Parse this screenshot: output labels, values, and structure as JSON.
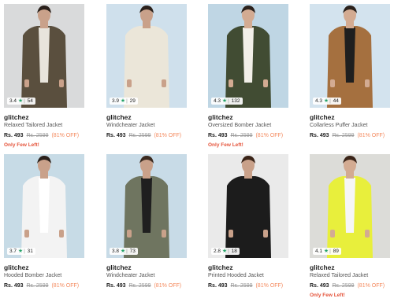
{
  "products": [
    {
      "brand": "glitchez",
      "name": "Relaxed Tailored Jacket",
      "rating": "3.4",
      "reviews": "54",
      "price": "Rs. 493",
      "mrp": "Rs. 2599",
      "discount": "(81% OFF)",
      "stock": "Only Few Left!",
      "bg": "#d9dadb",
      "jacket": "#5a4f3e",
      "shirt": "#e8e4dc",
      "pants": "#3e5e86",
      "skin": "#c9a18a",
      "hair": "#2a211c"
    },
    {
      "brand": "glitchez",
      "name": "Windcheater Jacket",
      "rating": "3.9",
      "reviews": "29",
      "price": "Rs. 493",
      "mrp": "Rs. 2599",
      "discount": "(81% OFF)",
      "stock": "",
      "bg": "#cfe0ec",
      "jacket": "#ebe6d9",
      "shirt": "#ebe6d9",
      "pants": "#c08048",
      "skin": "#c9a18a",
      "hair": "#2a211c"
    },
    {
      "brand": "glitchez",
      "name": "Oversized Bomber Jacket",
      "rating": "4.3",
      "reviews": "132",
      "price": "Rs. 493",
      "mrp": "Rs. 2599",
      "discount": "(81% OFF)",
      "stock": "Only Few Left!",
      "bg": "#bfd6e4",
      "jacket": "#414c33",
      "shirt": "#f2efe8",
      "pants": "#ece8df",
      "skin": "#d3ab92",
      "hair": "#2a211c"
    },
    {
      "brand": "glitchez",
      "name": "Collarless Puffer Jacket",
      "rating": "4.3",
      "reviews": "44",
      "price": "Rs. 493",
      "mrp": "Rs. 2599",
      "discount": "(81% OFF)",
      "stock": "",
      "bg": "#d3e3ee",
      "jacket": "#a5703f",
      "shirt": "#1f1f1f",
      "pants": "#1f1f1f",
      "skin": "#d3ab92",
      "hair": "#2a211c"
    },
    {
      "brand": "glitchez",
      "name": "Hooded Bomber Jacket",
      "rating": "3.7",
      "reviews": "31",
      "price": "Rs. 493",
      "mrp": "Rs. 2599",
      "discount": "(81% OFF)",
      "stock": "",
      "bg": "#c7dbe6",
      "jacket": "#f3f3f3",
      "shirt": "#ffffff",
      "pants": "#4a6a93",
      "skin": "#c9a18a",
      "hair": "#2a211c"
    },
    {
      "brand": "glitchez",
      "name": "Windcheater Jacket",
      "rating": "3.8",
      "reviews": "73",
      "price": "Rs. 493",
      "mrp": "Rs. 2599",
      "discount": "(81% OFF)",
      "stock": "",
      "bg": "#c8dbe7",
      "jacket": "#6f7560",
      "shirt": "#1f1f1f",
      "pants": "#1f1f1f",
      "skin": "#c9a18a",
      "hair": "#3a2a20"
    },
    {
      "brand": "glitchez",
      "name": "Printed Hooded Jacket",
      "rating": "2.8",
      "reviews": "18",
      "price": "Rs. 493",
      "mrp": "Rs. 2599",
      "discount": "(81% OFF)",
      "stock": "",
      "bg": "#eaeaea",
      "jacket": "#1c1c1c",
      "shirt": "#1c1c1c",
      "pants": "#2a2a2a",
      "skin": "#c9a18a",
      "hair": "#3a2418"
    },
    {
      "brand": "glitchez",
      "name": "Relaxed Tailored Jacket",
      "rating": "4.1",
      "reviews": "89",
      "price": "Rs. 493",
      "mrp": "Rs. 2599",
      "discount": "(81% OFF)",
      "stock": "Only Few Left!",
      "bg": "#dcdcd8",
      "jacket": "#e8ef3c",
      "shirt": "#f6f6f6",
      "pants": "#b0b4b8",
      "skin": "#d3ab92",
      "hair": "#3a2418"
    }
  ]
}
